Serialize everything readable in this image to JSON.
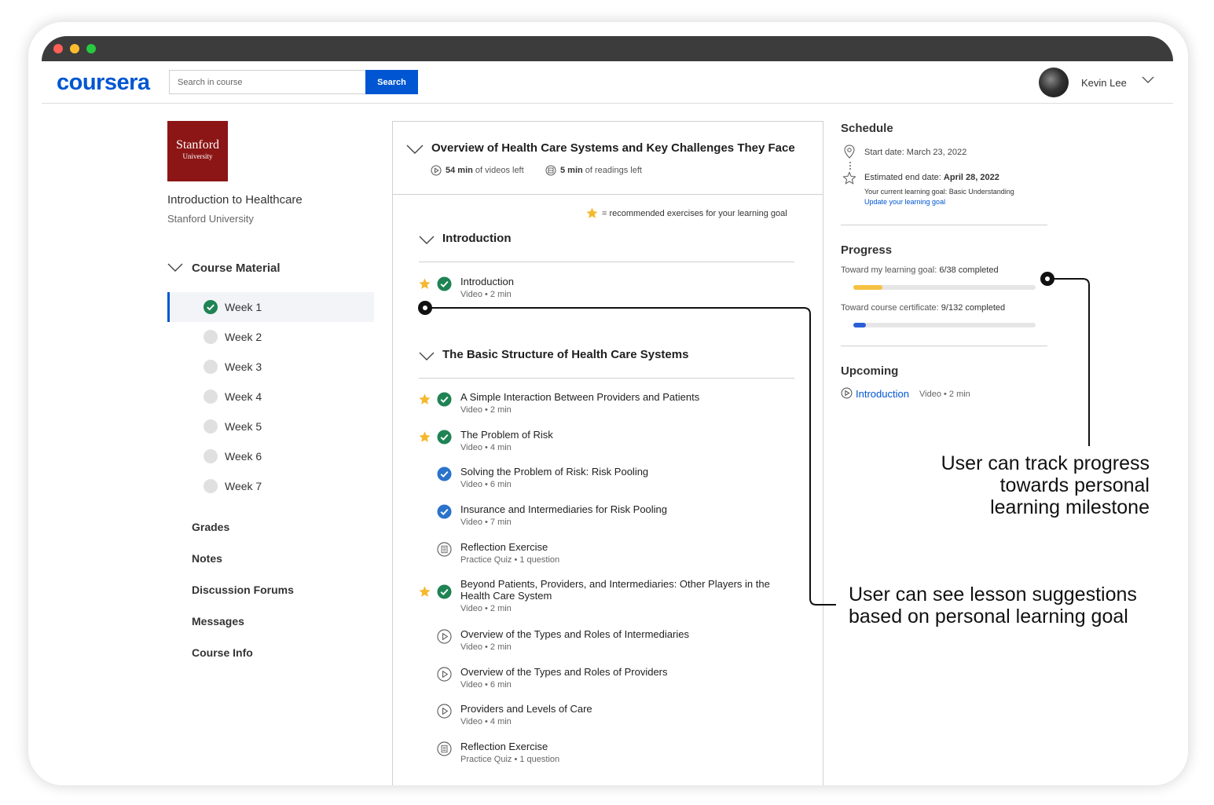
{
  "header": {
    "logo": "coursera",
    "search_placeholder": "Search in course",
    "search_button": "Search",
    "user_name": "Kevin Lee"
  },
  "sidebar": {
    "logo_big": "Stanford",
    "logo_small": "University",
    "course_title": "Introduction to Healthcare",
    "course_org": "Stanford University",
    "course_material_label": "Course Material",
    "weeks": [
      {
        "label": "Week 1",
        "completed": true
      },
      {
        "label": "Week 2",
        "completed": false
      },
      {
        "label": "Week 3",
        "completed": false
      },
      {
        "label": "Week 4",
        "completed": false
      },
      {
        "label": "Week 5",
        "completed": false
      },
      {
        "label": "Week 6",
        "completed": false
      },
      {
        "label": "Week 7",
        "completed": false
      }
    ],
    "links": [
      "Grades",
      "Notes",
      "Discussion Forums",
      "Messages",
      "Course Info"
    ]
  },
  "module": {
    "title": "Overview of Health Care Systems and Key Challenges They Face",
    "videos_left_bold": "54 min",
    "videos_left_rest": " of videos left",
    "readings_left_bold": "5 min",
    "readings_left_rest": " of readings left",
    "legend": "= recommended exercises for your learning goal",
    "sections": [
      {
        "title": "Introduction",
        "items": [
          {
            "title": "Introduction",
            "sub": "Video • 2 min",
            "star": true,
            "status": "done-green"
          }
        ]
      },
      {
        "title": "The Basic Structure of Health Care Systems",
        "items": [
          {
            "title": "A Simple Interaction Between Providers and Patients",
            "sub": "Video • 2 min",
            "star": true,
            "status": "done-green"
          },
          {
            "title": "The Problem of Risk",
            "sub": "Video • 4 min",
            "star": true,
            "status": "done-green"
          },
          {
            "title": "Solving the Problem of Risk: Risk Pooling",
            "sub": "Video • 6 min",
            "star": false,
            "status": "done-blue"
          },
          {
            "title": "Insurance and Intermediaries for Risk Pooling",
            "sub": "Video • 7 min",
            "star": false,
            "status": "done-blue"
          },
          {
            "title": "Reflection Exercise",
            "sub": "Practice Quiz • 1 question",
            "star": false,
            "status": "quiz"
          },
          {
            "title": "Beyond Patients, Providers, and Intermediaries: Other Players in the Health Care System",
            "sub": "Video • 2 min",
            "star": true,
            "status": "done-green"
          },
          {
            "title": "Overview of the Types and Roles of Intermediaries",
            "sub": "Video • 2 min",
            "star": false,
            "status": "video"
          },
          {
            "title": "Overview of the Types and Roles of Providers",
            "sub": "Video • 6 min",
            "star": false,
            "status": "video"
          },
          {
            "title": "Providers and Levels of Care",
            "sub": "Video • 4 min",
            "star": false,
            "status": "video"
          },
          {
            "title": "Reflection Exercise",
            "sub": "Practice Quiz • 1 question",
            "star": false,
            "status": "quiz"
          }
        ]
      }
    ]
  },
  "schedule": {
    "heading": "Schedule",
    "start": "Start date: March 23, 2022",
    "end_label": "Estimated end date: ",
    "end_date": "April 28, 2022",
    "goal": "Your current learning goal: Basic Understanding",
    "update_link": "Update your learning goal"
  },
  "progress": {
    "heading": "Progress",
    "goal_label": "Toward my learning goal: ",
    "goal_value": "6/38 completed",
    "goal_fraction": 0.158,
    "cert_label": "Toward course certificate: ",
    "cert_value": "9/132 completed",
    "cert_fraction": 0.068
  },
  "upcoming": {
    "heading": "Upcoming",
    "link": "Introduction",
    "meta": "Video • 2 min"
  },
  "annotations": {
    "progress_lines": [
      "User can track progress",
      "towards personal",
      "learning milestone"
    ],
    "suggestion_lines": [
      "User can see lesson suggestions",
      "based on personal learning goal"
    ]
  },
  "colors": {
    "brand": "#0056d2",
    "stanford": "#8c1515",
    "check_green": "#1f8354",
    "check_blue": "#2a73cc",
    "star": "#f5b82e",
    "progress_goal": "#f5c242",
    "progress_cert": "#2a5fd8"
  }
}
